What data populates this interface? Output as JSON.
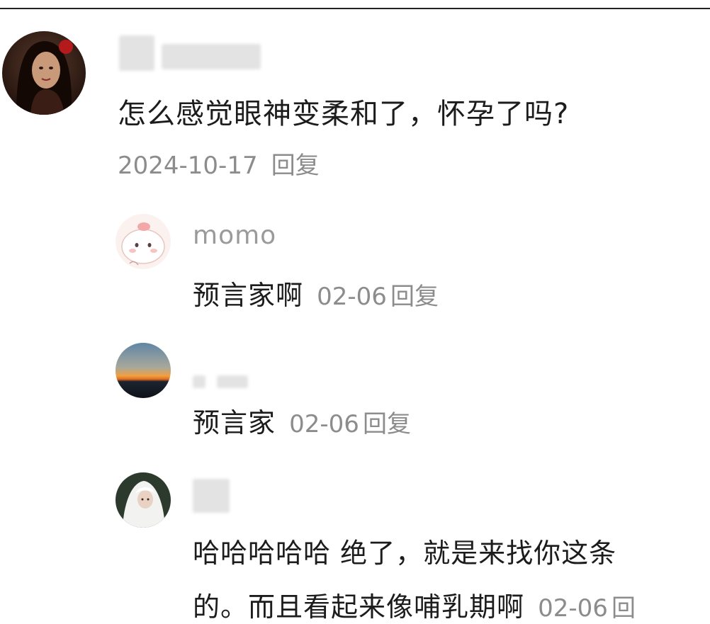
{
  "comments": [
    {
      "username": "",
      "text": "怎么感觉眼神变柔和了，怀孕了吗?",
      "date": "2024-10-17",
      "reply_label": "回复"
    },
    {
      "username": "momo",
      "text": "预言家啊",
      "date": "02-06",
      "reply_label": "回复"
    },
    {
      "username": "",
      "text": "预言家",
      "date": "02-06",
      "reply_label": "回复"
    },
    {
      "username": "",
      "text_line1": "哈哈哈哈哈 绝了，就是来找你这条",
      "text_line2": "的。而且看起来像哺乳期啊",
      "date": "02-06",
      "reply_label": "回"
    }
  ]
}
